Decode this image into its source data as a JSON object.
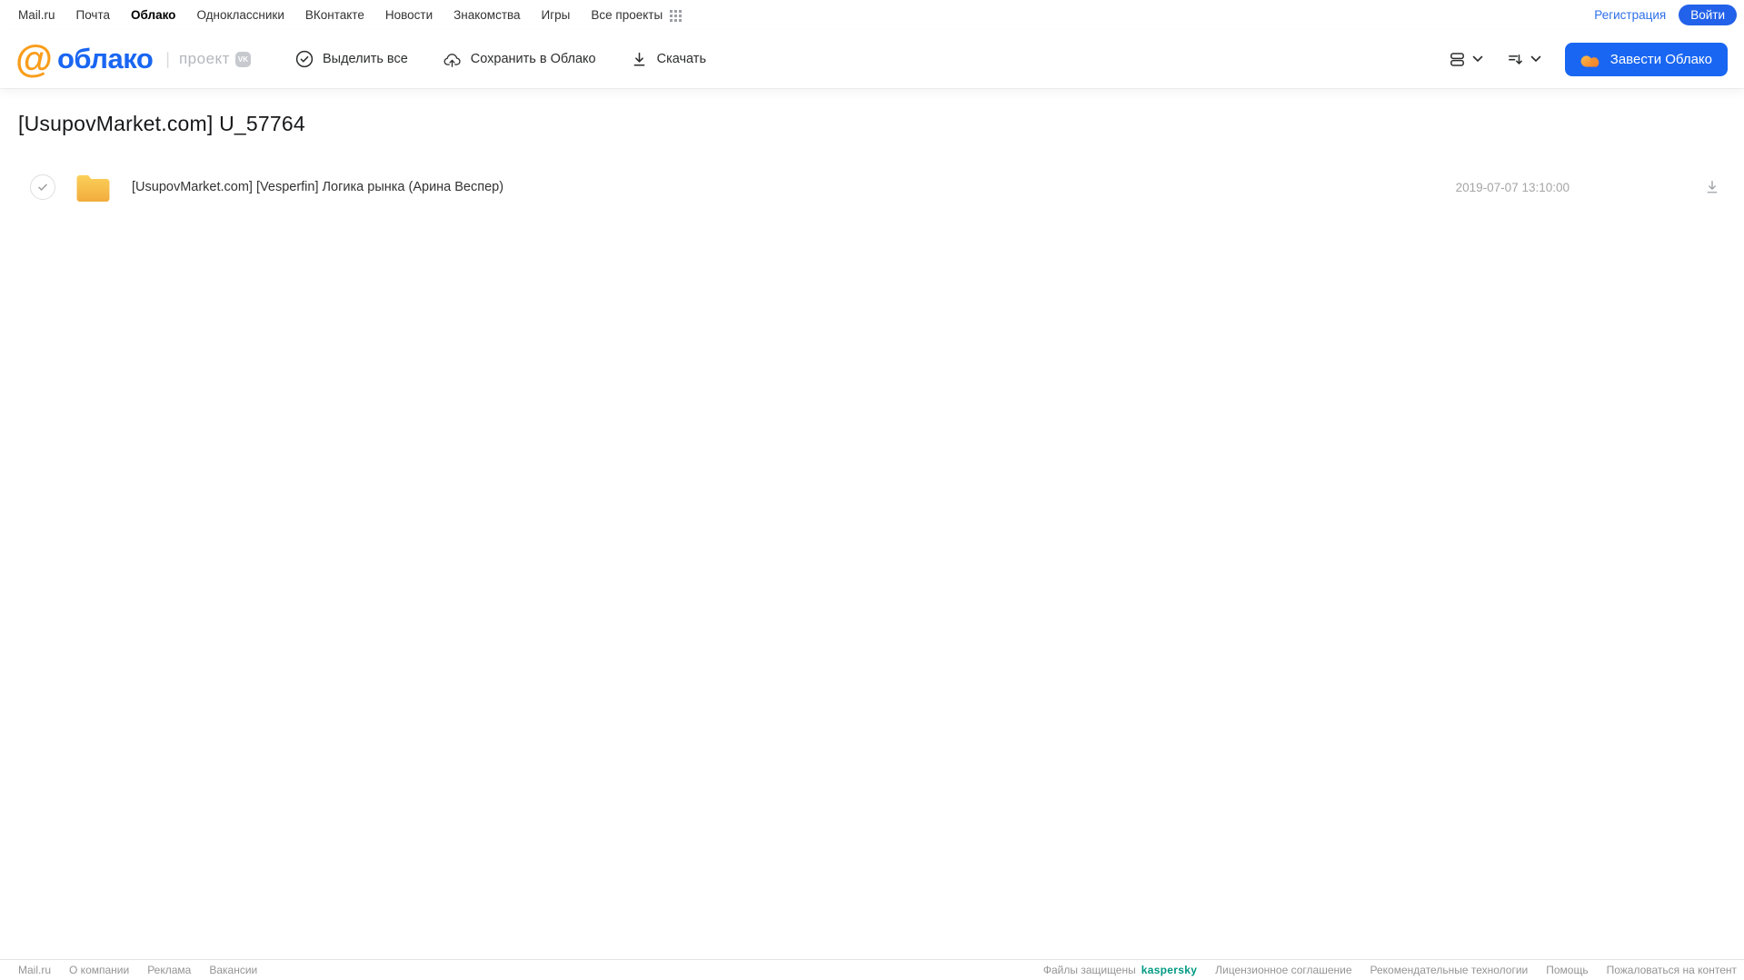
{
  "colors": {
    "accent": "#1966F2",
    "logo_orange": "#F99D1B",
    "folder_top": "#FBD05A",
    "folder_bottom": "#F2AC3C",
    "kaspersky_green": "#009A82"
  },
  "topnav": {
    "items": [
      {
        "label": "Mail.ru"
      },
      {
        "label": "Почта"
      },
      {
        "label": "Облако"
      },
      {
        "label": "Одноклассники"
      },
      {
        "label": "ВКонтакте"
      },
      {
        "label": "Новости"
      },
      {
        "label": "Знакомства"
      },
      {
        "label": "Игры"
      },
      {
        "label": "Все проекты"
      }
    ],
    "register_label": "Регистрация",
    "login_label": "Войти"
  },
  "header": {
    "logo_at": "@",
    "logo_text": "облако",
    "divider": "|",
    "project_label": "проект",
    "vk_badge": "VK",
    "toolbar": {
      "select_all": "Выделить все",
      "save_to_cloud": "Сохранить в Облако",
      "download": "Скачать"
    },
    "get_cloud_label": "Завести Облако"
  },
  "main": {
    "title": "[UsupovMarket.com] U_57764",
    "files": [
      {
        "name": "[UsupovMarket.com] [Vesperfin] Логика рынка (Арина Веспер)",
        "date": "2019-07-07 13:10:00"
      }
    ]
  },
  "footer": {
    "left_links": [
      "Mail.ru",
      "О компании",
      "Реклама",
      "Вакансии"
    ],
    "protected_label": "Файлы защищены",
    "kaspersky_label": "kaspersky",
    "right_links": [
      "Лицензионное соглашение",
      "Рекомендательные технологии",
      "Помощь",
      "Пожаловаться на контент"
    ]
  }
}
